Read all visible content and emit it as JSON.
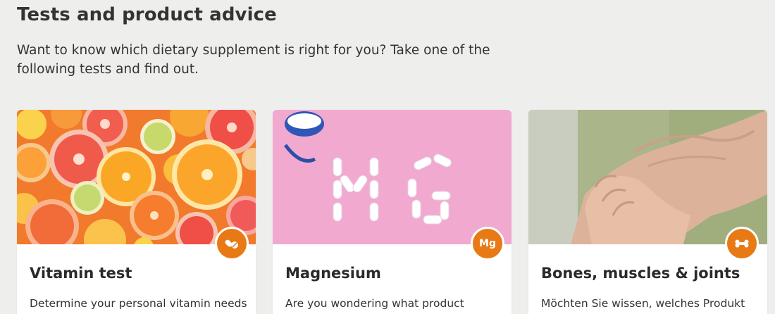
{
  "section": {
    "title": "Tests and product advice",
    "intro": "Want to know which dietary supplement is right for you? Take one of the following tests and find out."
  },
  "cards": [
    {
      "title": "Vitamin test",
      "text": "Determine your personal vitamin needs",
      "badge_icon": "pills-icon",
      "image": "citrus-fruit-slices"
    },
    {
      "title": "Magnesium",
      "text": "Are you wondering what product",
      "badge_label": "Mg",
      "badge_icon": "magnesium-icon",
      "image": "tablets-spelling-MG-on-pink"
    },
    {
      "title": "Bones, muscles & joints",
      "text": "Möchten Sie wissen, welches Produkt",
      "badge_icon": "bone-icon",
      "image": "hands-holding-wrist"
    }
  ],
  "colors": {
    "page_background": "#eeefed",
    "badge": "#e87a16",
    "card_background": "#ffffff",
    "text": "#2b2b2b"
  }
}
